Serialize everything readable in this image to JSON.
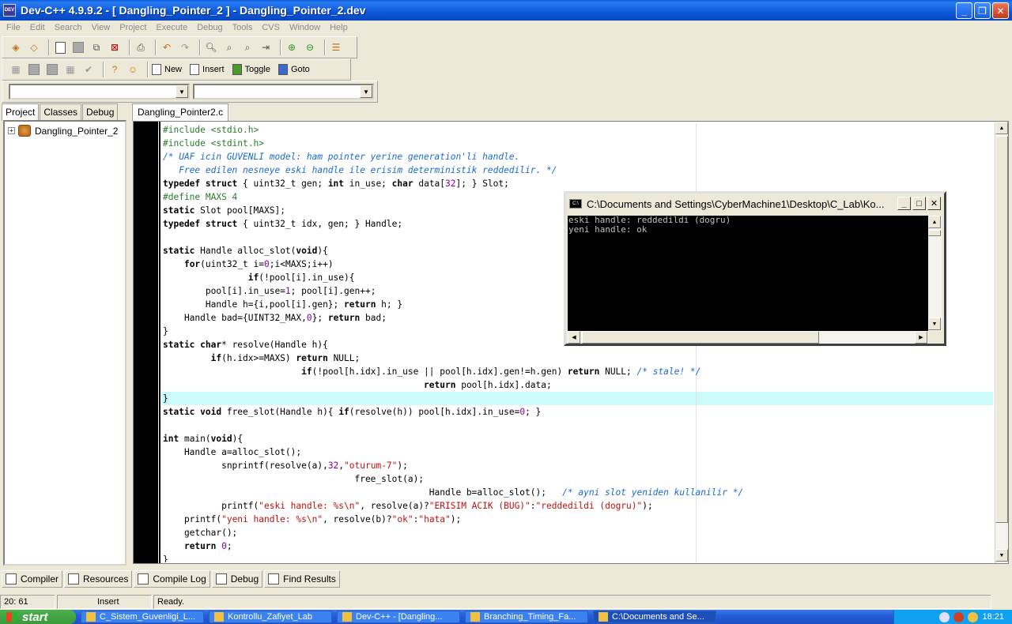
{
  "window": {
    "title": "Dev-C++ 4.9.9.2  - [ Dangling_Pointer_2 ] - Dangling_Pointer_2.dev",
    "icon_text": "DEV"
  },
  "menu": [
    "File",
    "Edit",
    "Search",
    "View",
    "Project",
    "Execute",
    "Debug",
    "Tools",
    "CVS",
    "Window",
    "Help"
  ],
  "toolbar2": {
    "new_label": "New",
    "insert_label": "Insert",
    "toggle_label": "Toggle",
    "goto_label": "Goto"
  },
  "left_tabs": [
    "Project",
    "Classes",
    "Debug"
  ],
  "project_tree": {
    "root": "Dangling_Pointer_2"
  },
  "editor": {
    "tab": "Dangling_Pointer2.c",
    "highlight_line": 20,
    "lines": [
      [
        [
          "pp",
          "#include <stdio.h>"
        ]
      ],
      [
        [
          "pp",
          "#include <stdint.h>"
        ]
      ],
      [
        [
          "cm",
          "/* UAF icin GUVENLI model: ham pointer yerine generation'li handle."
        ]
      ],
      [
        [
          "cm",
          "   Free edilen nesneye eski handle ile erisim deterministik reddedilir. */"
        ]
      ],
      [
        [
          "kw",
          "typedef struct"
        ],
        [
          "",
          " { uint32_t gen; "
        ],
        [
          "kw",
          "int"
        ],
        [
          "",
          " in_use; "
        ],
        [
          "kw",
          "char"
        ],
        [
          "",
          " data["
        ],
        [
          "nm",
          "32"
        ],
        [
          "",
          "]; } Slot;"
        ]
      ],
      [
        [
          "pp",
          "#define MAXS 4"
        ]
      ],
      [
        [
          "kw",
          "static"
        ],
        [
          "",
          " Slot pool[MAXS];"
        ]
      ],
      [
        [
          "kw",
          "typedef struct"
        ],
        [
          "",
          " { uint32_t idx, gen; } Handle;"
        ]
      ],
      [
        [
          "",
          ""
        ]
      ],
      [
        [
          "kw",
          "static"
        ],
        [
          "",
          " Handle alloc_slot("
        ],
        [
          "kw",
          "void"
        ],
        [
          "",
          "){"
        ]
      ],
      [
        [
          "",
          "    "
        ],
        [
          "kw",
          "for"
        ],
        [
          "",
          "(uint32_t i="
        ],
        [
          "nm",
          "0"
        ],
        [
          "",
          ";i<MAXS;i++)"
        ]
      ],
      [
        [
          "",
          "                "
        ],
        [
          "kw",
          "if"
        ],
        [
          "",
          "(!pool[i].in_use){"
        ]
      ],
      [
        [
          "",
          "        pool[i].in_use="
        ],
        [
          "nm",
          "1"
        ],
        [
          "",
          "; pool[i].gen++;"
        ]
      ],
      [
        [
          "",
          "        Handle h={i,pool[i].gen}; "
        ],
        [
          "kw",
          "return"
        ],
        [
          "",
          " h; }"
        ]
      ],
      [
        [
          "",
          "    Handle bad={UINT32_MAX,"
        ],
        [
          "nm",
          "0"
        ],
        [
          "",
          "}; "
        ],
        [
          "kw",
          "return"
        ],
        [
          "",
          " bad;"
        ]
      ],
      [
        [
          "",
          "}"
        ]
      ],
      [
        [
          "kw",
          "static char"
        ],
        [
          "",
          "* resolve(Handle h){"
        ]
      ],
      [
        [
          "",
          "         "
        ],
        [
          "kw",
          "if"
        ],
        [
          "",
          "(h.idx>=MAXS) "
        ],
        [
          "kw",
          "return"
        ],
        [
          "",
          " NULL;"
        ]
      ],
      [
        [
          "",
          "                          "
        ],
        [
          "kw",
          "if"
        ],
        [
          "",
          "(!pool[h.idx].in_use || pool[h.idx].gen!=h.gen) "
        ],
        [
          "kw",
          "return"
        ],
        [
          "",
          " NULL; "
        ],
        [
          "cm",
          "/* stale! */"
        ]
      ],
      [
        [
          "",
          "                                                 "
        ],
        [
          "kw",
          "return"
        ],
        [
          "",
          " pool[h.idx].data;"
        ]
      ],
      [
        [
          "",
          "}"
        ]
      ],
      [
        [
          "kw",
          "static void"
        ],
        [
          "",
          " free_slot(Handle h){ "
        ],
        [
          "kw",
          "if"
        ],
        [
          "",
          "(resolve(h)) pool[h.idx].in_use="
        ],
        [
          "nm",
          "0"
        ],
        [
          "",
          "; }"
        ]
      ],
      [
        [
          "",
          ""
        ]
      ],
      [
        [
          "kw",
          "int"
        ],
        [
          "",
          " main("
        ],
        [
          "kw",
          "void"
        ],
        [
          "",
          "){"
        ]
      ],
      [
        [
          "",
          "    Handle a=alloc_slot();"
        ]
      ],
      [
        [
          "",
          "           snprintf(resolve(a),"
        ],
        [
          "nm",
          "32"
        ],
        [
          "",
          ","
        ],
        [
          "st",
          "\"oturum-7\""
        ],
        [
          "",
          ");"
        ]
      ],
      [
        [
          "",
          "                                    free_slot(a);"
        ]
      ],
      [
        [
          "",
          "                                                  Handle b=alloc_slot();   "
        ],
        [
          "cm",
          "/* ayni slot yeniden kullanilir */"
        ]
      ],
      [
        [
          "",
          "           printf("
        ],
        [
          "st",
          "\"eski handle: %s\\n\""
        ],
        [
          "",
          ", resolve(a)?"
        ],
        [
          "st",
          "\"ERISIM ACIK (BUG)\""
        ],
        [
          "",
          ":"
        ],
        [
          "st",
          "\"reddedildi (dogru)\""
        ],
        [
          "",
          ");"
        ]
      ],
      [
        [
          "",
          "    printf("
        ],
        [
          "st",
          "\"yeni handle: %s\\n\""
        ],
        [
          "",
          ", resolve(b)?"
        ],
        [
          "st",
          "\"ok\""
        ],
        [
          "",
          ":"
        ],
        [
          "st",
          "\"hata\""
        ],
        [
          "",
          ");"
        ]
      ],
      [
        [
          "",
          "    getchar();"
        ]
      ],
      [
        [
          "",
          "    "
        ],
        [
          "kw",
          "return"
        ],
        [
          "",
          " "
        ],
        [
          "nm",
          "0"
        ],
        [
          "",
          ";"
        ]
      ],
      [
        [
          "",
          "}"
        ]
      ]
    ]
  },
  "console": {
    "title": "C:\\Documents and Settings\\CyberMachine1\\Desktop\\C_Lab\\Ko...",
    "icon_text": "C:\\",
    "output": [
      "eski handle: reddedildi (dogru)",
      "yeni handle: ok"
    ]
  },
  "bottom_tabs": [
    "Compiler",
    "Resources",
    "Compile Log",
    "Debug",
    "Find Results"
  ],
  "status": {
    "position": "20: 61",
    "mode": "Insert",
    "message": "Ready."
  },
  "taskbar": {
    "start": "start",
    "tasks": [
      "C_Sistem_Guvenligi_L...",
      "Kontrollu_Zafiyet_Lab",
      "Dev-C++ - [Dangling...",
      "Branching_Timing_Fa...",
      "C:\\Documents and Se..."
    ],
    "active_task": 4,
    "clock": "18:21"
  }
}
